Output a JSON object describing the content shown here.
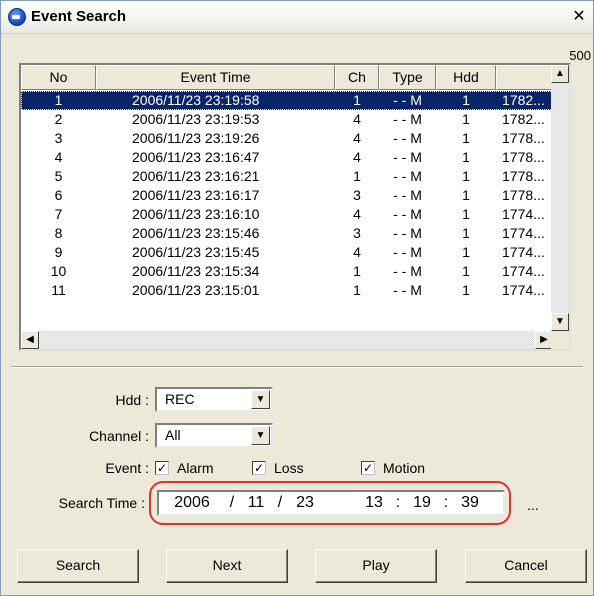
{
  "window": {
    "title": "Event Search",
    "close_glyph": "✕"
  },
  "count_label": "500",
  "table": {
    "headers": [
      "No",
      "Event Time",
      "Ch",
      "Type",
      "Hdd",
      ""
    ],
    "selected_index": 0,
    "rows": [
      [
        "1",
        "2006/11/23  23:19:58",
        "1",
        "- - M",
        "1",
        "1782..."
      ],
      [
        "2",
        "2006/11/23  23:19:53",
        "4",
        "- - M",
        "1",
        "1782..."
      ],
      [
        "3",
        "2006/11/23  23:19:26",
        "4",
        "- - M",
        "1",
        "1778..."
      ],
      [
        "4",
        "2006/11/23  23:16:47",
        "4",
        "- - M",
        "1",
        "1778..."
      ],
      [
        "5",
        "2006/11/23  23:16:21",
        "1",
        "- - M",
        "1",
        "1778..."
      ],
      [
        "6",
        "2006/11/23  23:16:17",
        "3",
        "- - M",
        "1",
        "1778..."
      ],
      [
        "7",
        "2006/11/23  23:16:10",
        "4",
        "- - M",
        "1",
        "1774..."
      ],
      [
        "8",
        "2006/11/23  23:15:46",
        "3",
        "- - M",
        "1",
        "1774..."
      ],
      [
        "9",
        "2006/11/23  23:15:45",
        "4",
        "- - M",
        "1",
        "1774..."
      ],
      [
        "10",
        "2006/11/23  23:15:34",
        "1",
        "- - M",
        "1",
        "1774..."
      ],
      [
        "11",
        "2006/11/23  23:15:01",
        "1",
        "- - M",
        "1",
        "1774..."
      ]
    ]
  },
  "form": {
    "hdd_label": "Hdd :",
    "hdd_value": "REC",
    "channel_label": "Channel :",
    "channel_value": "All",
    "event_label": "Event :",
    "events": [
      {
        "label": "Alarm",
        "checked": true
      },
      {
        "label": "Loss",
        "checked": true
      },
      {
        "label": "Motion",
        "checked": true
      }
    ],
    "search_time_label": "Search Time :",
    "search_time": {
      "year": "2006",
      "month": "11",
      "day": "23",
      "hour": "13",
      "minute": "19",
      "second": "39"
    },
    "date_sep": "/",
    "time_sep": ":",
    "more_label": "..."
  },
  "buttons": {
    "search": "Search",
    "next": "Next",
    "play": "Play",
    "cancel": "Cancel"
  },
  "colors": {
    "selection": "#0a246a",
    "highlight_ring": "#e03030",
    "face": "#ece9d8"
  }
}
